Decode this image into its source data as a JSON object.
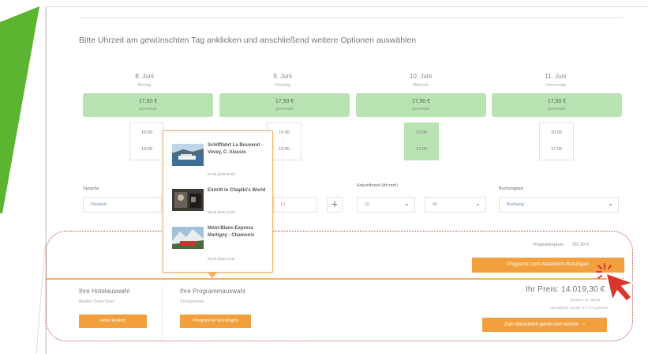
{
  "instruction": "Bitte Uhrzeit am gewünschten Tag anklicken und anschließend weitere Optionen auswählen",
  "days": [
    {
      "date": "8. Juni",
      "weekday": "Montag",
      "price": "17,50 €",
      "per": "pro Person",
      "times": [
        "10:00",
        "19:00"
      ],
      "selected": false
    },
    {
      "date": "9. Juni",
      "weekday": "Dienstag",
      "price": "17,50 €",
      "per": "pro Person",
      "times": [
        "10:00",
        "19:00"
      ],
      "selected": false
    },
    {
      "date": "10. Juni",
      "weekday": "Mittwoch",
      "price": "17,50 €",
      "per": "pro Person",
      "times": [
        "10:00",
        "17:00"
      ],
      "selected": true
    },
    {
      "date": "11. Juni",
      "weekday": "Donnerstag",
      "price": "17,50 €",
      "per": "pro Person",
      "times": [
        "10:00",
        "17:00"
      ],
      "selected": false
    }
  ],
  "options": {
    "language_label": "Sprache",
    "language_value": "Deutsch",
    "persons_value": "10",
    "arrival_label": "Ankunftszeit (hh:mm)",
    "arrival_hour": "10",
    "arrival_minute": "00",
    "booking_label": "Buchungsart",
    "booking_value": "Buchung"
  },
  "popup": {
    "items": [
      {
        "name": "Schifffahrt La Bouveret - Vevey, C. Alassio",
        "date": "07.06.2020 09:00"
      },
      {
        "name": "Eintritt in Chaplin's World",
        "date": "08.06.2020 10:00"
      },
      {
        "name": "Mont-Blanc-Express Martigny - Chamonix",
        "date": "09.06.2020 13:46"
      }
    ]
  },
  "program_price": {
    "label": "Programmpreis:",
    "value": "787,20 €"
  },
  "buttons": {
    "add_program": "Programm zum Warenkorb hinzufügen",
    "hotel": "Hotel ändern",
    "program": "Programme hinzufügen",
    "cart": "Zum Warenkorb gehen und buchen"
  },
  "hotel": {
    "title": "Ihre Hotelauswahl",
    "value": "Modern Times Hotel"
  },
  "program": {
    "title": "Ihre Programmauswahl",
    "value": "3 Programme"
  },
  "total": {
    "label": "Ihr Preis: 14.019,30 €",
    "line1": "(Zusatz inkl. MwSt)",
    "line2": "Vertragliche Anzahl: 17 / 8 ft gebucht"
  },
  "colors": {
    "accent": "#f2a03d",
    "green_tile": "#b9e3b3",
    "brand_green": "#5cb531",
    "highlight": "#c4433d"
  }
}
